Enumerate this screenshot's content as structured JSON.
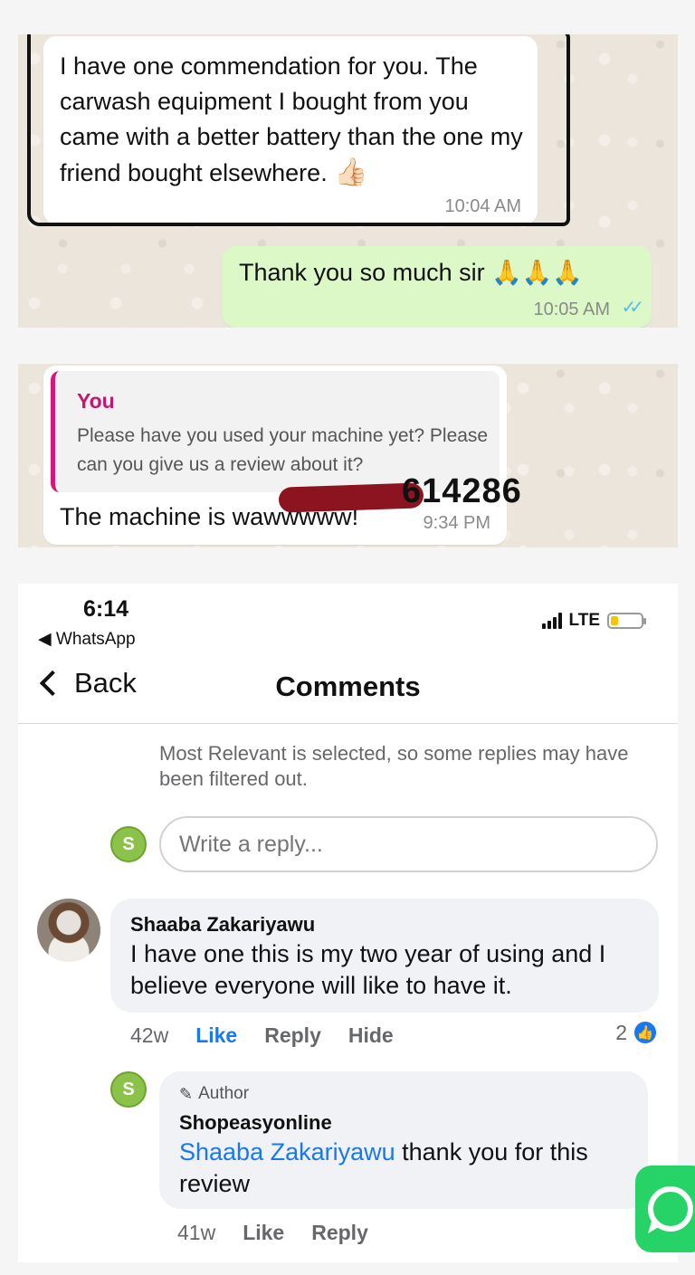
{
  "chat1": {
    "incoming": {
      "text": "I have one commendation for you. The carwash equipment I bought from you came with a better battery than the one my friend bought elsewhere.",
      "emoji": "👍🏻",
      "time": "10:04 AM"
    },
    "outgoing": {
      "text": "Thank you so much sir 🙏🙏🙏",
      "time": "10:05 AM",
      "ticks": "✓✓"
    }
  },
  "chat2": {
    "quoted_author": "You",
    "quoted_text": "Please have you used your machine yet? Please can you give us a review about it?",
    "text": "The machine is wawwwww!",
    "time": "9:34 PM",
    "phone_visible": "614286"
  },
  "fb": {
    "status_time": "6:14",
    "back_app": "◀ WhatsApp",
    "network": "LTE",
    "battery_level": 0.25,
    "back_label": "Back",
    "title": "Comments",
    "filter_note": "Most Relevant is selected, so some replies may have been filtered out.",
    "reply_placeholder": "Write a reply...",
    "avatar_letter": "S",
    "comment": {
      "author": "Shaaba Zakariyawu",
      "text": "I have one this is my two year of using and I believe everyone will like to have it.",
      "age": "42w",
      "like": "Like",
      "reply": "Reply",
      "hide": "Hide",
      "reaction_count": "2"
    },
    "reply": {
      "tag": "Author",
      "author": "Shopeasyonline",
      "mention": "Shaaba Zakariyawu",
      "text": " thank you for this review",
      "age": "41w",
      "like": "Like",
      "reply": "Reply"
    }
  },
  "colors": {
    "whatsapp_bg": "#ece5dc",
    "outgoing_bubble": "#dcf8c6",
    "fb_blue": "#1877f2",
    "quote_accent": "#d4197a"
  }
}
